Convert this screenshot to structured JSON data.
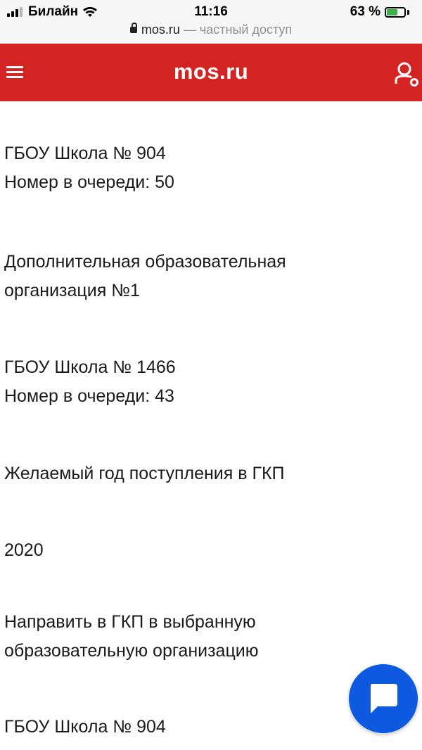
{
  "status_bar": {
    "carrier": "Билайн",
    "time": "11:16",
    "battery_text": "63 %",
    "battery_level_percent": 63
  },
  "browser": {
    "domain": "mos.ru",
    "private_label": "— частный доступ"
  },
  "header": {
    "logo": "mos.ru",
    "brand_color": "#d32323"
  },
  "content": [
    {
      "lines": [
        "ГБОУ Школа № 904",
        "Номер в очереди: 50"
      ]
    },
    {
      "lines": [
        "Дополнительная образовательная",
        "организация №1"
      ]
    },
    {
      "lines": [
        "ГБОУ Школа № 1466",
        "Номер в очереди: 43"
      ]
    },
    {
      "lines": [
        "Желаемый год поступления в ГКП"
      ]
    },
    {
      "lines": [
        "2020"
      ]
    },
    {
      "lines": [
        "Направить в ГКП в выбранную",
        "образовательную организацию"
      ]
    },
    {
      "lines": [
        "ГБОУ Школа № 904"
      ]
    }
  ],
  "chat_button": {
    "icon": "chat-icon",
    "color": "#0d5ae0"
  }
}
